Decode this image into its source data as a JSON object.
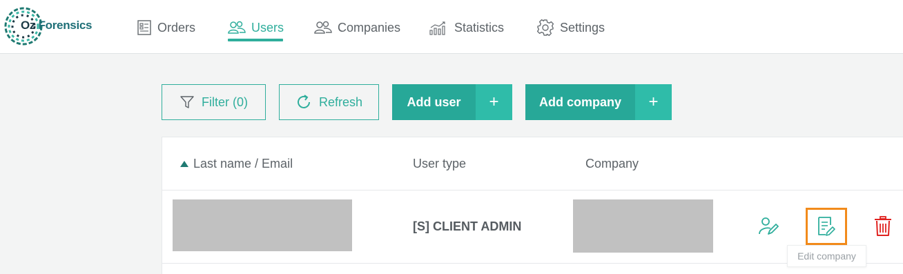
{
  "brand": {
    "name_part1": "Oz",
    "name_part2": "Forensics",
    "accent_color": "#2fae9c"
  },
  "nav": {
    "items": [
      {
        "label": "Orders",
        "icon": "orders-icon",
        "active": false
      },
      {
        "label": "Users",
        "icon": "users-icon",
        "active": true
      },
      {
        "label": "Companies",
        "icon": "companies-icon",
        "active": false
      },
      {
        "label": "Statistics",
        "icon": "statistics-icon",
        "active": false
      },
      {
        "label": "Settings",
        "icon": "gear-icon",
        "active": false
      }
    ]
  },
  "toolbar": {
    "filter_label": "Filter (0)",
    "refresh_label": "Refresh",
    "add_user_label": "Add user",
    "add_company_label": "Add company",
    "plus_symbol": "+"
  },
  "table": {
    "columns": [
      "Last name / Email",
      "User type",
      "Company"
    ],
    "sort": {
      "column": "Last name / Email",
      "direction": "ascending"
    },
    "rows": [
      {
        "name_email": "",
        "user_type": "[S] CLIENT ADMIN",
        "company": "",
        "name_redacted": true,
        "company_redacted": true
      }
    ],
    "row_actions": [
      {
        "icon": "user-edit-icon",
        "color": "#2fae9c"
      },
      {
        "icon": "edit-company-icon",
        "color": "#2fae9c",
        "focused": true
      },
      {
        "icon": "trash-icon",
        "color": "#e0221f"
      }
    ]
  },
  "tooltip": {
    "text": "Edit company"
  },
  "colors": {
    "primary": "#27a898",
    "primary_light": "#2fbca9",
    "danger": "#e0221f",
    "focus": "#f28b1b",
    "redaction": "#c1c1c1"
  }
}
